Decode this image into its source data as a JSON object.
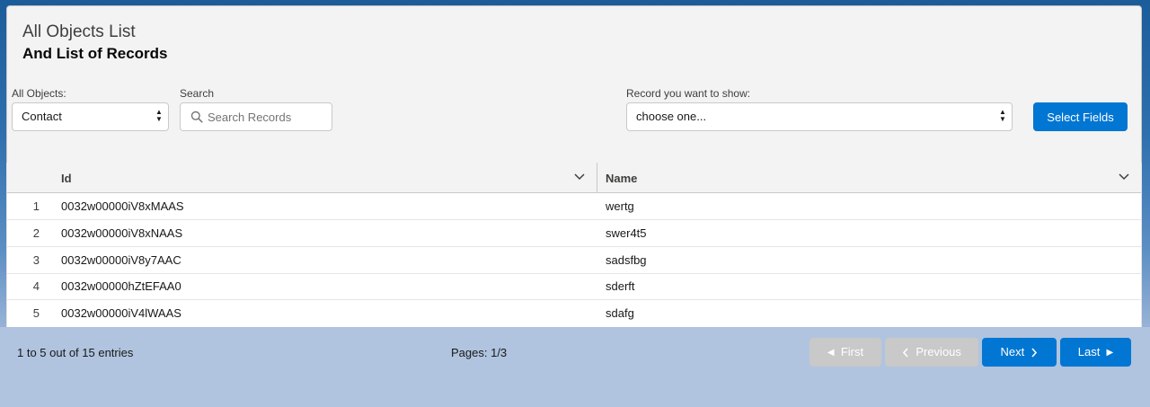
{
  "header": {
    "title": "All Objects List",
    "subtitle": "And List of Records"
  },
  "filters": {
    "objects_label": "All Objects:",
    "objects_value": "Contact",
    "search_label": "Search",
    "search_placeholder": "Search Records",
    "record_label": "Record you want to show:",
    "record_value": "choose one...",
    "select_fields_label": "Select Fields"
  },
  "table": {
    "columns": [
      "Id",
      "Name"
    ],
    "rows": [
      {
        "num": "1",
        "id": "0032w00000iV8xMAAS",
        "name": "wertg"
      },
      {
        "num": "2",
        "id": "0032w00000iV8xNAAS",
        "name": "swer4t5"
      },
      {
        "num": "3",
        "id": "0032w00000iV8y7AAC",
        "name": "sadsfbg"
      },
      {
        "num": "4",
        "id": "0032w00000hZtEFAA0",
        "name": "sderft"
      },
      {
        "num": "5",
        "id": "0032w00000iV4lWAAS",
        "name": "sdafg"
      }
    ]
  },
  "pagination": {
    "entries_text": "1 to 5 out of 15 entries",
    "pages_text": "Pages: 1/3",
    "first_label": "First",
    "previous_label": "Previous",
    "next_label": "Next",
    "last_label": "Last"
  },
  "colors": {
    "brand": "#0176d3",
    "disabled": "#c9c9c9",
    "page_bg": "#b0c4df"
  }
}
